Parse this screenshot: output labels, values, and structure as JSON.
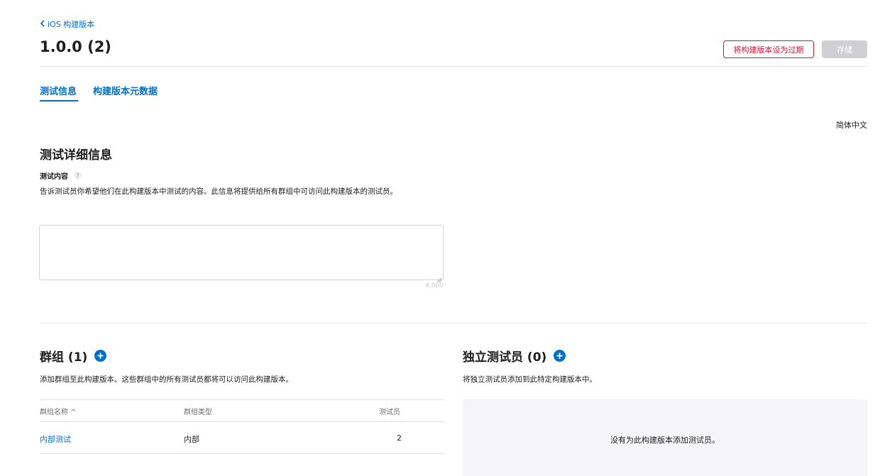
{
  "header": {
    "back_label": "iOS 构建版本",
    "title": "1.0.0 (2)",
    "expire_button": "将构建版本设为过期",
    "save_button": "存储"
  },
  "tabs": [
    {
      "label": "测试信息",
      "active": true
    },
    {
      "label": "构建版本元数据",
      "active": false
    }
  ],
  "language": "简体中文",
  "test_details": {
    "heading": "测试详细信息",
    "field_label": "测试内容",
    "help": "?",
    "description": "告诉测试员你希望他们在此构建版本中测试的内容。此信息将提供给所有群组中可访问此构建版本的测试员。",
    "value": "",
    "char_limit": "4,000"
  },
  "groups": {
    "heading": "群组 (1)",
    "description": "添加群组至此构建版本。这些群组中的所有测试员都将可以访问此构建版本。",
    "columns": [
      "群组名称 ^",
      "群组类型",
      "测试员"
    ],
    "rows": [
      {
        "name": "内部测试",
        "type": "内部",
        "testers": "2"
      }
    ]
  },
  "individual_testers": {
    "heading": "独立测试员 (0)",
    "description": "将独立测试员添加到此特定构建版本中。",
    "empty_message": "没有为此构建版本添加测试员。"
  },
  "colors": {
    "accent": "#0070c9",
    "danger": "#d9152e",
    "disabled": "#d0d0d3",
    "empty_bg": "#f5f5f7"
  }
}
